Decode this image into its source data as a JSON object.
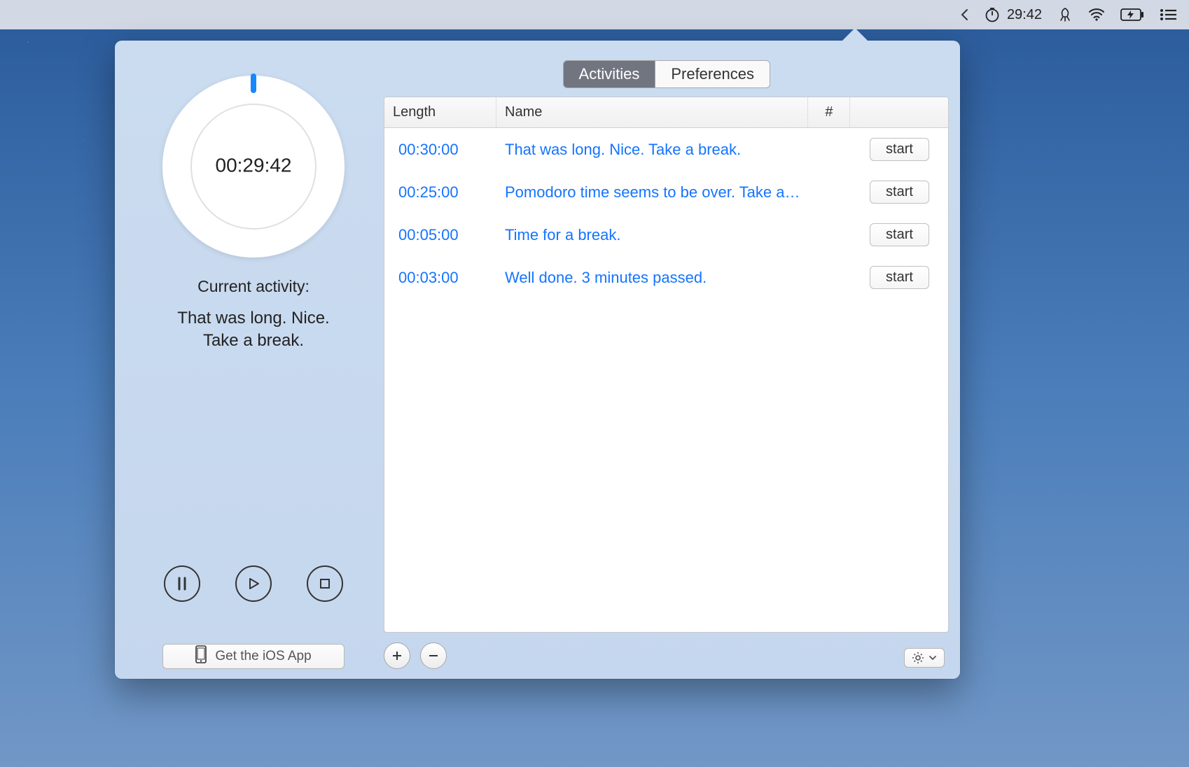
{
  "menubar": {
    "timer_display": "29:42"
  },
  "popover": {
    "timer": {
      "time_text": "00:29:42"
    },
    "current_activity_label": "Current activity:",
    "current_activity_text": "That was long. Nice. Take a break.",
    "ios_button_label": "Get the iOS App",
    "tabs": {
      "activities": "Activities",
      "preferences": "Preferences"
    },
    "table": {
      "headers": {
        "length": "Length",
        "name": "Name",
        "hash": "#"
      },
      "rows": [
        {
          "length": "00:30:00",
          "name": "That was long. Nice. Take a break.",
          "start": "start"
        },
        {
          "length": "00:25:00",
          "name": "Pomodoro time seems to be over. Take a…",
          "start": "start"
        },
        {
          "length": "00:05:00",
          "name": "Time for a break.",
          "start": "start"
        },
        {
          "length": "00:03:00",
          "name": "Well done. 3 minutes passed.",
          "start": "start"
        }
      ]
    }
  }
}
